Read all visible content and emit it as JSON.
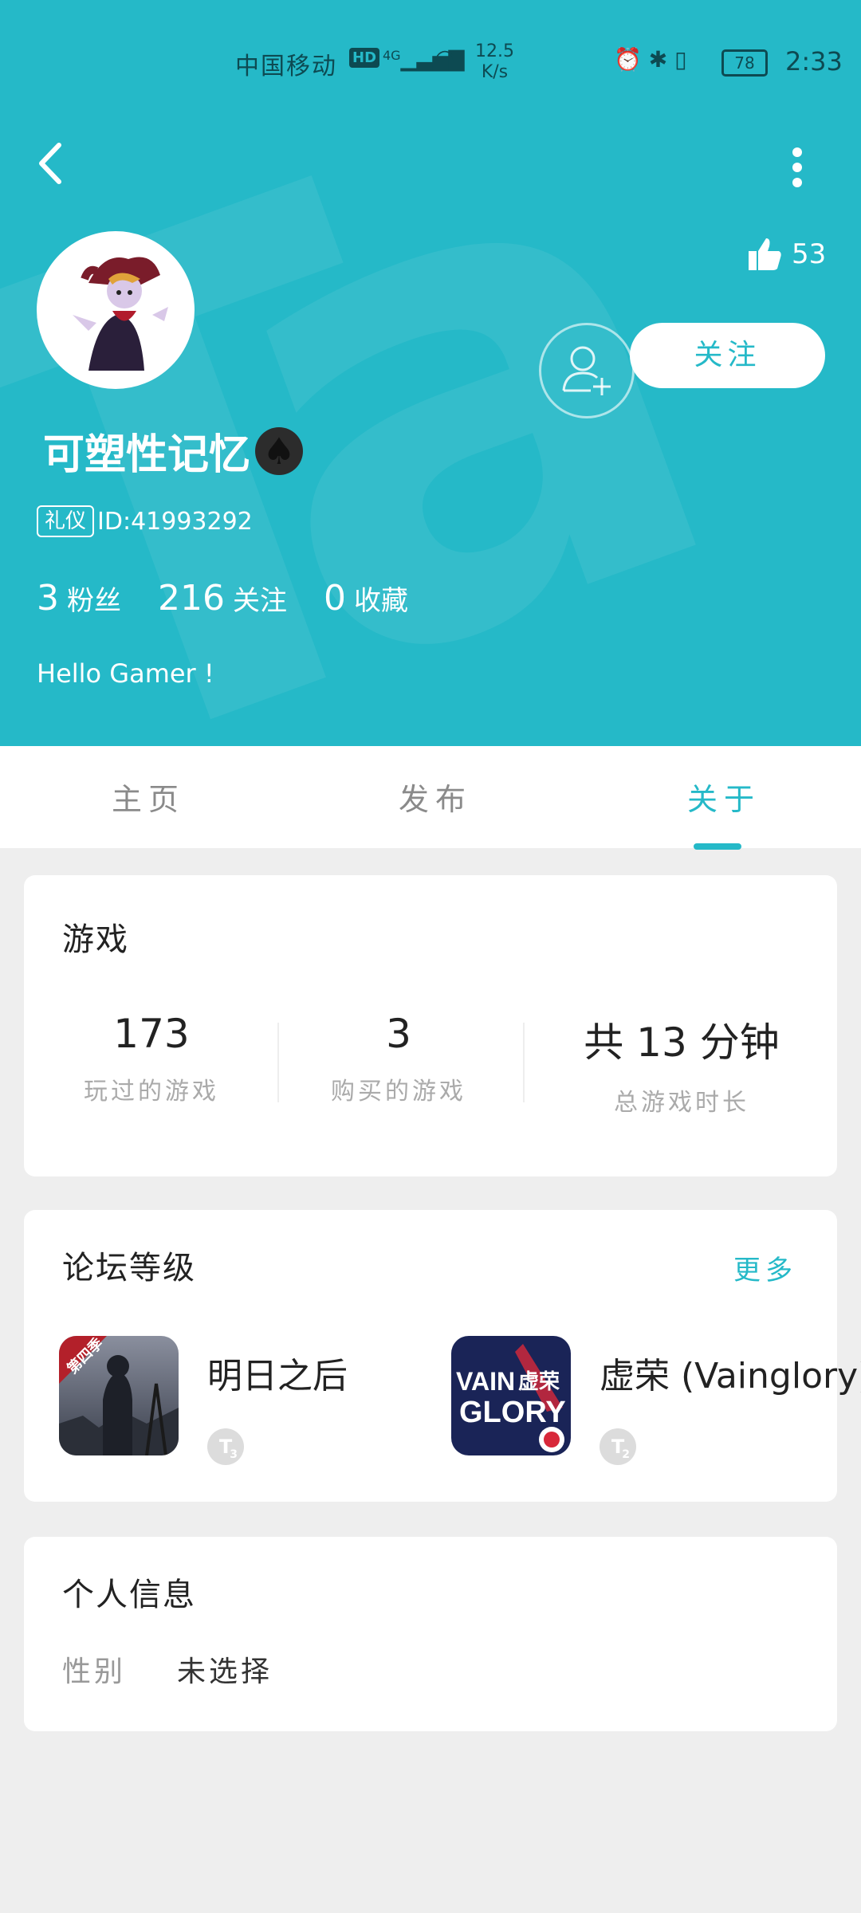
{
  "status_bar": {
    "carrier": "中国移动",
    "hd": "HD",
    "network": "4G",
    "speed_value": "12.5",
    "speed_unit": "K/s",
    "battery": "78",
    "time": "2:33"
  },
  "profile": {
    "likes": "53",
    "follow_label": "关注",
    "username": "可塑性记忆",
    "username_suffix_icon": "spade-icon",
    "badge": "礼仪",
    "user_id": "ID:41993292",
    "fans_count": "3",
    "fans_label": "粉丝",
    "following_count": "216",
    "following_label": "关注",
    "favorites_count": "0",
    "favorites_label": "收藏",
    "bio": "Hello Gamer !"
  },
  "tabs": [
    {
      "label": "主页"
    },
    {
      "label": "发布"
    },
    {
      "label": "关于",
      "active": true
    }
  ],
  "games_card": {
    "title": "游戏",
    "stats": [
      {
        "value": "173",
        "label": "玩过的游戏"
      },
      {
        "value": "3",
        "label": "购买的游戏"
      },
      {
        "value": "共 13 分钟",
        "label": "总游戏时长"
      }
    ]
  },
  "forum_card": {
    "title": "论坛等级",
    "more_label": "更多",
    "items": [
      {
        "name": "明日之后",
        "icon_badge": "第四季",
        "level": "T",
        "level_num": "3"
      },
      {
        "name": "虚荣 (Vainglory)",
        "icon_text_1": "VAIN",
        "icon_text_2": "虚荣",
        "icon_text_3": "GLORY",
        "level": "T",
        "level_num": "2"
      }
    ]
  },
  "info_card": {
    "title": "个人信息",
    "gender_key": "性别",
    "gender_value": "未选择"
  },
  "colors": {
    "accent": "#25b9c8",
    "background": "#eeeeee"
  }
}
